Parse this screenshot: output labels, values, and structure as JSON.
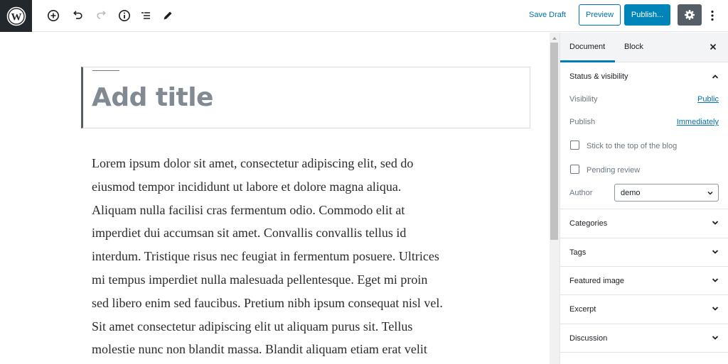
{
  "topbar": {
    "logo": "wordpress-logo",
    "tools": [
      {
        "name": "add-block",
        "icon": "plus-circle-icon"
      },
      {
        "name": "undo",
        "icon": "undo-icon"
      },
      {
        "name": "redo",
        "icon": "redo-icon"
      },
      {
        "name": "info",
        "icon": "info-icon"
      },
      {
        "name": "outline",
        "icon": "list-icon"
      },
      {
        "name": "edit",
        "icon": "pencil-icon"
      }
    ],
    "save_draft": "Save Draft",
    "preview": "Preview",
    "publish": "Publish...",
    "settings_icon": "gear-icon",
    "more_icon": "more-vertical-icon"
  },
  "editor": {
    "title_placeholder": "Add title",
    "paragraph_lines": [
      "Lorem ipsum dolor sit amet, consectetur adipiscing elit, sed do",
      "eiusmod tempor incididunt ut labore et dolore magna aliqua.",
      "Aliquam nulla facilisi cras fermentum odio. Commodo elit at",
      "imperdiet dui accumsan sit amet. Convallis convallis tellus id",
      "interdum. Tristique risus nec feugiat in fermentum posuere. Ultrices",
      "mi tempus imperdiet nulla malesuada pellentesque. Eget mi proin",
      "sed libero enim sed faucibus. Pretium nibh ipsum consequat nisl vel.",
      "Sit amet consectetur adipiscing elit ut aliquam purus sit. Tellus",
      "molestie nunc non blandit massa. Blandit aliquam etiam erat velit"
    ]
  },
  "sidebar": {
    "tabs": [
      {
        "label": "Document",
        "active": true
      },
      {
        "label": "Block",
        "active": false
      }
    ],
    "close_icon": "close-icon",
    "status_panel": {
      "title": "Status & visibility",
      "expanded": true,
      "visibility_label": "Visibility",
      "visibility_value": "Public",
      "publish_label": "Publish",
      "publish_value": "Immediately",
      "stick_to_top": {
        "label": "Stick to the top of the blog",
        "checked": false
      },
      "pending_review": {
        "label": "Pending review",
        "checked": false
      },
      "author_label": "Author",
      "author_value": "demo"
    },
    "panels": [
      {
        "title": "Categories"
      },
      {
        "title": "Tags"
      },
      {
        "title": "Featured image"
      },
      {
        "title": "Excerpt"
      },
      {
        "title": "Discussion"
      }
    ]
  },
  "colors": {
    "accent": "#0085ba",
    "link": "#0073aa",
    "dark": "#23282d"
  }
}
